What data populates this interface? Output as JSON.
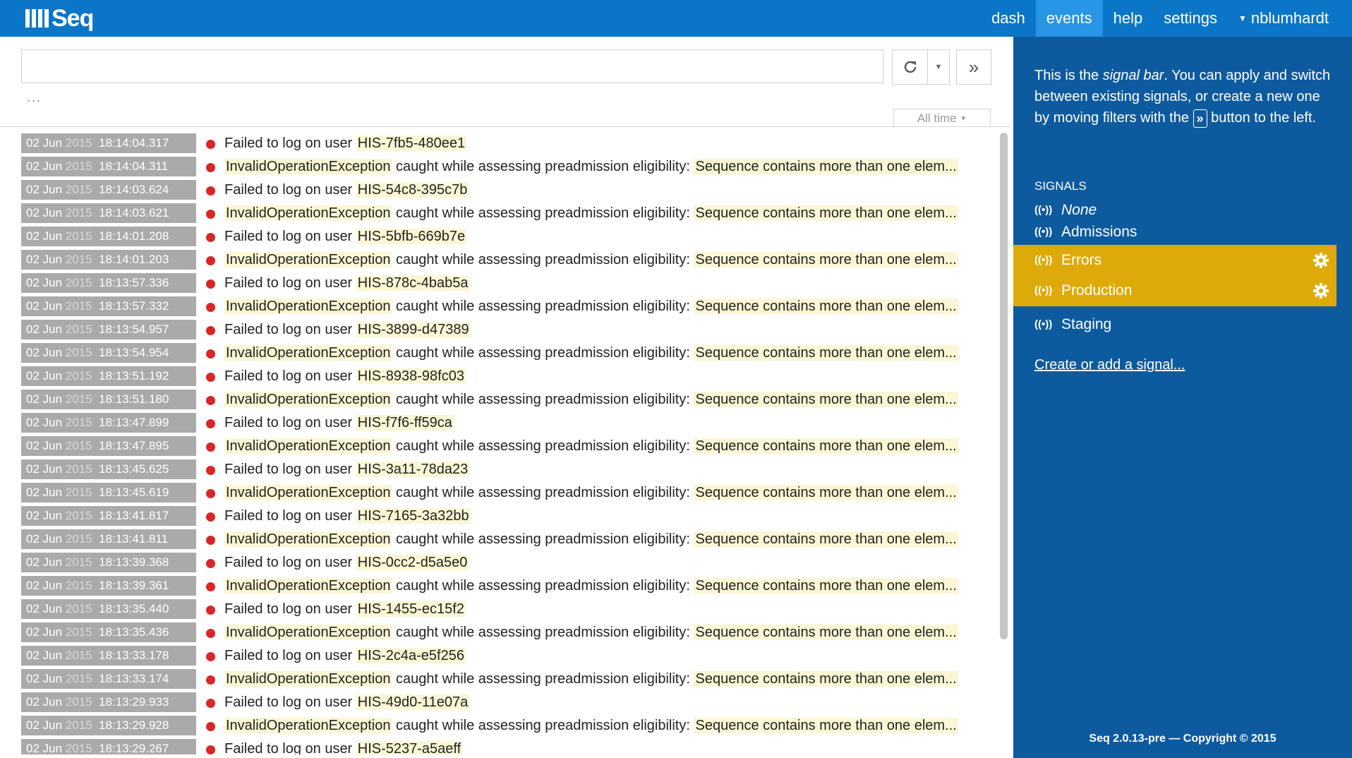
{
  "app": {
    "logo_text": "Seq"
  },
  "nav": {
    "items": [
      {
        "label": "dash",
        "active": false
      },
      {
        "label": "events",
        "active": true
      },
      {
        "label": "help",
        "active": false
      },
      {
        "label": "settings",
        "active": false
      }
    ],
    "user": "nblumhardt"
  },
  "search": {
    "value": "",
    "placeholder": ""
  },
  "toolbar": {
    "ellipsis": "...",
    "time_range": "All time",
    "move_glyph": "»"
  },
  "events": [
    {
      "day": "02 Jun",
      "year": "2015",
      "time": "18:14:04.317",
      "type": "logon",
      "user_id": "HIS-7fb5-480ee1"
    },
    {
      "day": "02 Jun",
      "year": "2015",
      "time": "18:14:04.311",
      "type": "exception"
    },
    {
      "day": "02 Jun",
      "year": "2015",
      "time": "18:14:03.624",
      "type": "logon",
      "user_id": "HIS-54c8-395c7b"
    },
    {
      "day": "02 Jun",
      "year": "2015",
      "time": "18:14:03.621",
      "type": "exception"
    },
    {
      "day": "02 Jun",
      "year": "2015",
      "time": "18:14:01.208",
      "type": "logon",
      "user_id": "HIS-5bfb-669b7e"
    },
    {
      "day": "02 Jun",
      "year": "2015",
      "time": "18:14:01.203",
      "type": "exception"
    },
    {
      "day": "02 Jun",
      "year": "2015",
      "time": "18:13:57.336",
      "type": "logon",
      "user_id": "HIS-878c-4bab5a"
    },
    {
      "day": "02 Jun",
      "year": "2015",
      "time": "18:13:57.332",
      "type": "exception"
    },
    {
      "day": "02 Jun",
      "year": "2015",
      "time": "18:13:54.957",
      "type": "logon",
      "user_id": "HIS-3899-d47389"
    },
    {
      "day": "02 Jun",
      "year": "2015",
      "time": "18:13:54.954",
      "type": "exception"
    },
    {
      "day": "02 Jun",
      "year": "2015",
      "time": "18:13:51.192",
      "type": "logon",
      "user_id": "HIS-8938-98fc03"
    },
    {
      "day": "02 Jun",
      "year": "2015",
      "time": "18:13:51.180",
      "type": "exception"
    },
    {
      "day": "02 Jun",
      "year": "2015",
      "time": "18:13:47.899",
      "type": "logon",
      "user_id": "HIS-f7f6-ff59ca"
    },
    {
      "day": "02 Jun",
      "year": "2015",
      "time": "18:13:47.895",
      "type": "exception"
    },
    {
      "day": "02 Jun",
      "year": "2015",
      "time": "18:13:45.625",
      "type": "logon",
      "user_id": "HIS-3a11-78da23"
    },
    {
      "day": "02 Jun",
      "year": "2015",
      "time": "18:13:45.619",
      "type": "exception"
    },
    {
      "day": "02 Jun",
      "year": "2015",
      "time": "18:13:41.817",
      "type": "logon",
      "user_id": "HIS-7165-3a32bb"
    },
    {
      "day": "02 Jun",
      "year": "2015",
      "time": "18:13:41.811",
      "type": "exception"
    },
    {
      "day": "02 Jun",
      "year": "2015",
      "time": "18:13:39.368",
      "type": "logon",
      "user_id": "HIS-0cc2-d5a5e0"
    },
    {
      "day": "02 Jun",
      "year": "2015",
      "time": "18:13:39.361",
      "type": "exception"
    },
    {
      "day": "02 Jun",
      "year": "2015",
      "time": "18:13:35.440",
      "type": "logon",
      "user_id": "HIS-1455-ec15f2"
    },
    {
      "day": "02 Jun",
      "year": "2015",
      "time": "18:13:35.436",
      "type": "exception"
    },
    {
      "day": "02 Jun",
      "year": "2015",
      "time": "18:13:33.178",
      "type": "logon",
      "user_id": "HIS-2c4a-e5f256"
    },
    {
      "day": "02 Jun",
      "year": "2015",
      "time": "18:13:33.174",
      "type": "exception"
    },
    {
      "day": "02 Jun",
      "year": "2015",
      "time": "18:13:29.933",
      "type": "logon",
      "user_id": "HIS-49d0-11e07a"
    },
    {
      "day": "02 Jun",
      "year": "2015",
      "time": "18:13:29.928",
      "type": "exception"
    },
    {
      "day": "02 Jun",
      "year": "2015",
      "time": "18:13:29.267",
      "type": "logon",
      "user_id": "HIS-5237-a5aeff"
    }
  ],
  "messages": {
    "logon_prefix": "Failed to log on user ",
    "exception_type": "InvalidOperationException",
    "exception_middle": " caught while assessing preadmission eligibility: ",
    "exception_detail": "Sequence contains more than one elem..."
  },
  "signal_bar": {
    "intro_1": "This is the ",
    "intro_em": "signal bar",
    "intro_2": ". You can apply and switch between existing signals, or create a new one by moving filters with the ",
    "intro_glyph": "»",
    "intro_3": " button to the left.",
    "title": "SIGNALS",
    "signals": [
      {
        "label": "None",
        "active": false,
        "italic": true
      },
      {
        "label": "Admissions",
        "active": false,
        "italic": false
      },
      {
        "label": "Errors",
        "active": true,
        "italic": false
      },
      {
        "label": "Production",
        "active": true,
        "italic": false
      },
      {
        "label": "Staging",
        "active": false,
        "italic": false
      }
    ],
    "signal_icon": "((•))",
    "create_link": "Create or add a signal...",
    "footer": "Seq 2.0.13-pre — Copyright © 2015"
  },
  "colors": {
    "topbar": "#0b76c7",
    "nav_active": "#2896e6",
    "signal_bar": "#0e5a9e",
    "signal_active": "#deaa0a",
    "level_error": "#d92626",
    "timestamp_bg": "#aaaaaa",
    "highlight": "#fbf6d4"
  }
}
